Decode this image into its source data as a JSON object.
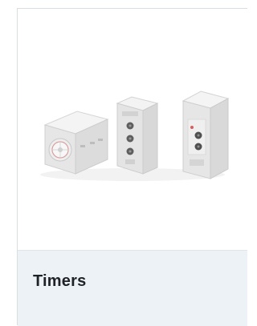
{
  "card": {
    "title": "Timers",
    "image_icon": "timer-products-image"
  }
}
